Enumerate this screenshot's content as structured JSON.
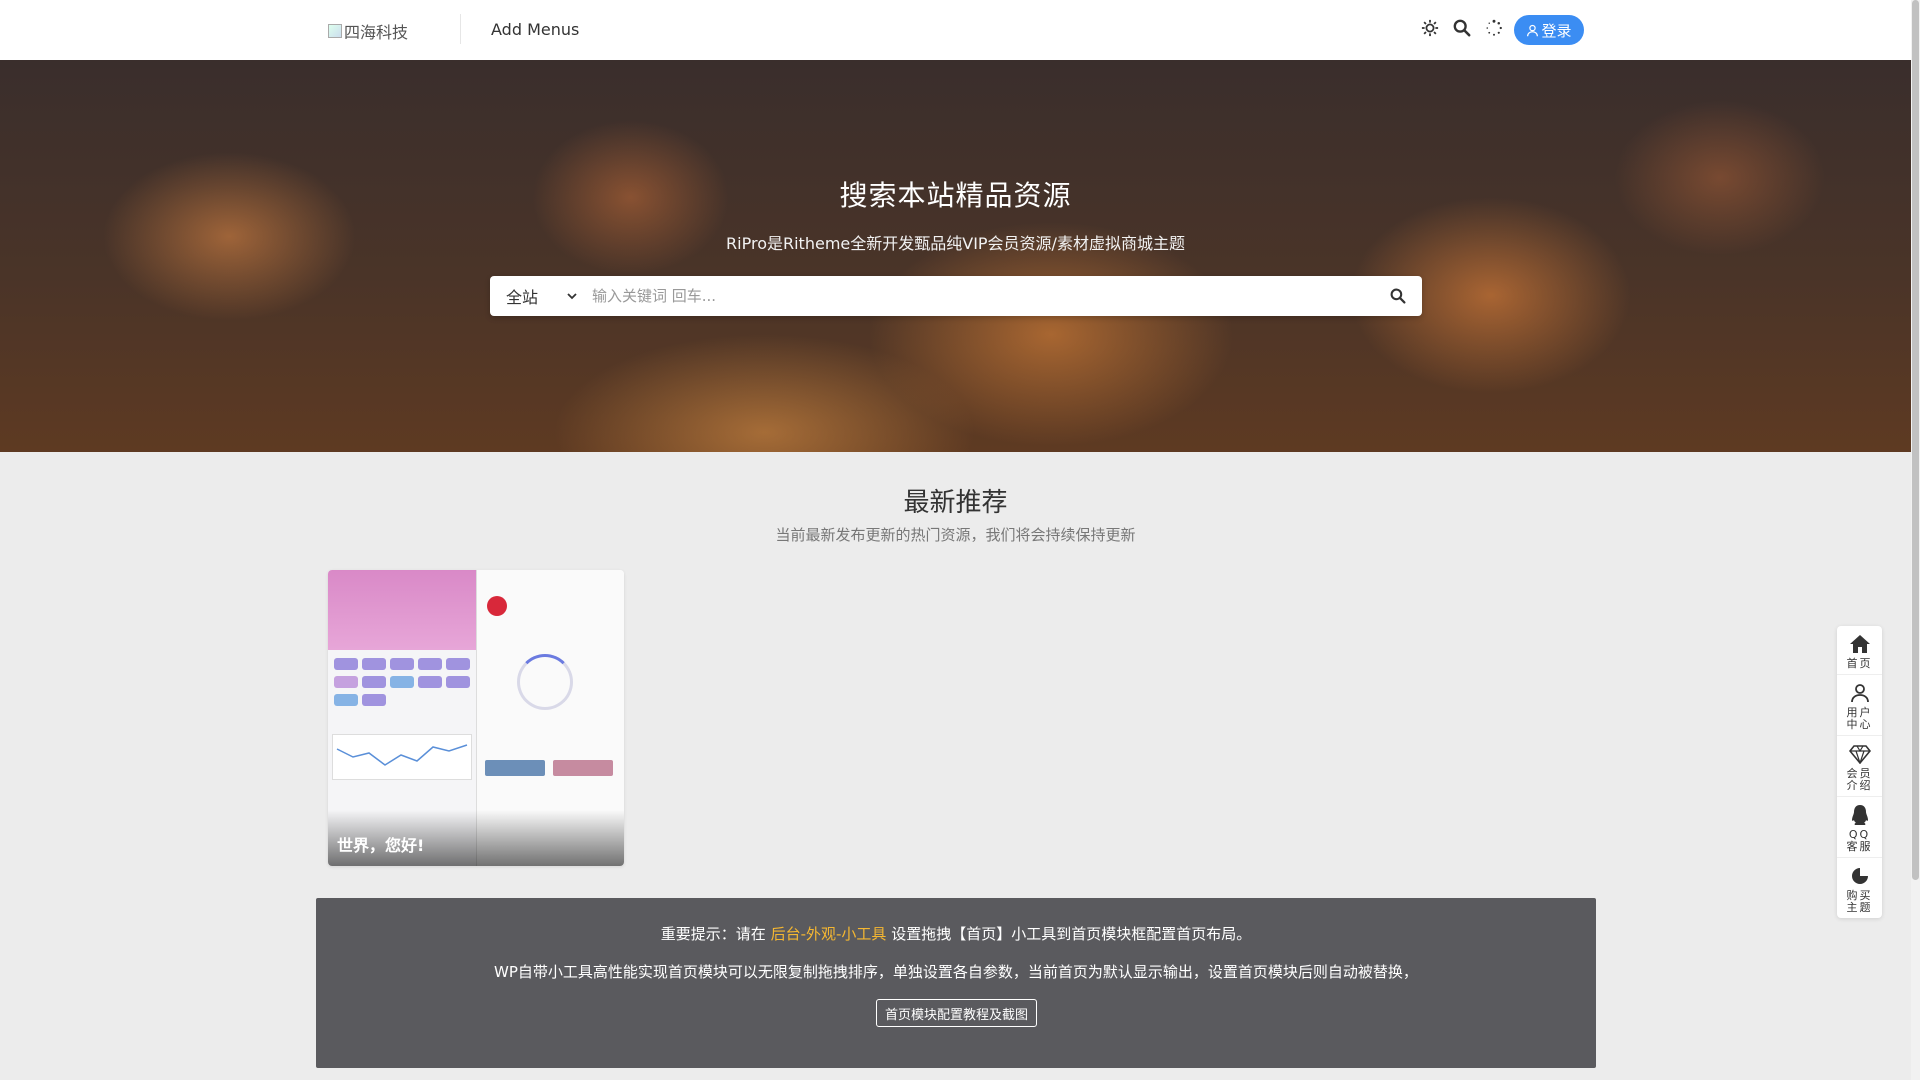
{
  "header": {
    "logo_alt": "四海科技",
    "menu_label": "Add Menus",
    "login_label": "登录",
    "icons": [
      "theme-toggle-icon",
      "search-icon",
      "loading-icon",
      "user-icon"
    ]
  },
  "hero": {
    "title": "搜索本站精品资源",
    "subtitle": "RiPro是Ritheme全新开发甄品纯VIP会员资源/素材虚拟商城主题",
    "search": {
      "scope_value": "全站",
      "placeholder": "输入关键词 回车..."
    }
  },
  "latest": {
    "title": "最新推荐",
    "subtitle": "当前最新发布更新的热门资源，我们将会持续保持更新",
    "posts": [
      {
        "title": "世界，您好!"
      }
    ]
  },
  "notice": {
    "line1_prefix": "重要提示：请在",
    "line1_link": "后台-外观-小工具",
    "line1_suffix": "设置拖拽【首页】小工具到首页模块框配置首页布局。",
    "line2": "WP自带小工具高性能实现首页模块可以无限复制拖拽排序，单独设置各自参数，当前首页为默认显示输出，设置首页模块后则自动被替换，",
    "button_label": "首页模块配置教程及截图"
  },
  "sidenav": {
    "items": [
      {
        "label": "首页",
        "icon": "home-icon"
      },
      {
        "label": "用户中心",
        "icon": "user-icon"
      },
      {
        "label": "会员介绍",
        "icon": "diamond-icon"
      },
      {
        "label": "QQ客服",
        "icon": "qq-icon"
      },
      {
        "label": "购买主题",
        "icon": "shop-icon"
      }
    ]
  },
  "colors": {
    "accent": "#3b8df3",
    "notice_bg": "#5a5a5e",
    "highlight": "#f5b731"
  }
}
